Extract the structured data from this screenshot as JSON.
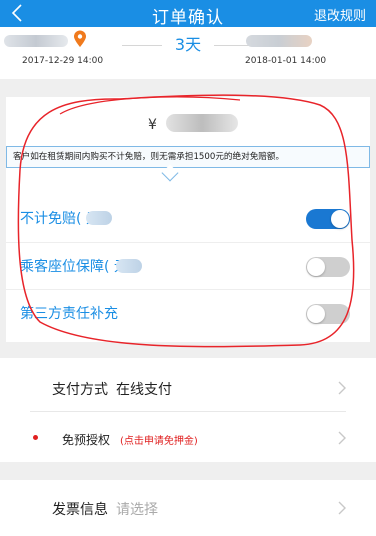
{
  "nav": {
    "title": "订单确认",
    "rules_label": "退改规则"
  },
  "trip": {
    "duration": "3天",
    "pickup_date": "2017-12-29 14:00",
    "return_date": "2018-01-01 14:00"
  },
  "insurance": {
    "currency": "¥",
    "notice": "客户如在租赁期间内购买不计免赔，则无需承担1500元的绝对免赔额。",
    "items": [
      {
        "label": "不计免赔(  元)",
        "enabled": true
      },
      {
        "label": "乘客座位保障(  元)",
        "enabled": false
      },
      {
        "label": "第三方责任补充",
        "enabled": false
      }
    ]
  },
  "payment": {
    "method_label": "支付方式",
    "method_value": "在线支付",
    "preauth_label": "免预授权",
    "preauth_hint": "(点击申请免押金)",
    "invoice_label": "发票信息",
    "invoice_placeholder": "请选择"
  },
  "colors": {
    "primary": "#1a8ee4",
    "toggle_on": "#1a78d2",
    "annotation": "#e8242a",
    "alert": "#e02020"
  }
}
